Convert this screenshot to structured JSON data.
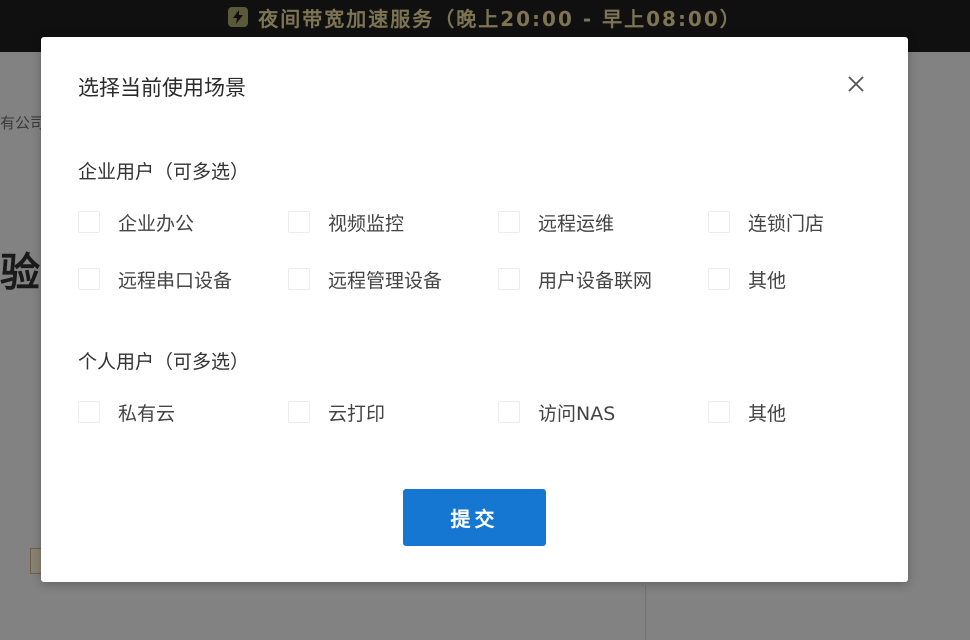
{
  "banner": {
    "text": "夜间带宽加速服务（晚上20:00 - 早上08:00）",
    "icon": "bolt-icon"
  },
  "background": {
    "company_partial": "有公司",
    "heading_partial": "验"
  },
  "modal": {
    "title": "选择当前使用场景",
    "close_icon": "close-icon",
    "enterprise": {
      "title": "企业用户（可多选）",
      "options": [
        {
          "label": "企业办公",
          "checked": false
        },
        {
          "label": "视频监控",
          "checked": false
        },
        {
          "label": "远程运维",
          "checked": false
        },
        {
          "label": "连锁门店",
          "checked": false
        },
        {
          "label": "远程串口设备",
          "checked": false
        },
        {
          "label": "远程管理设备",
          "checked": false
        },
        {
          "label": "用户设备联网",
          "checked": false
        },
        {
          "label": "其他",
          "checked": false
        }
      ]
    },
    "personal": {
      "title": "个人用户（可多选）",
      "options": [
        {
          "label": "私有云",
          "checked": false
        },
        {
          "label": "云打印",
          "checked": false
        },
        {
          "label": "访问NAS",
          "checked": false
        },
        {
          "label": "其他",
          "checked": false
        }
      ]
    },
    "submit_label": "提交"
  },
  "colors": {
    "primary": "#1677d2",
    "overlay": "#828282",
    "banner_bg": "#101010"
  }
}
